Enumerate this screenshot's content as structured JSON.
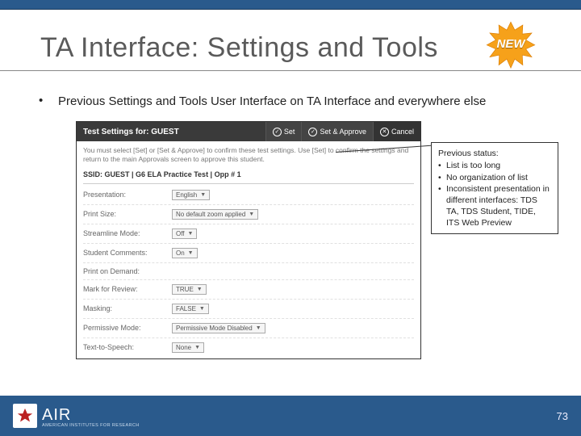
{
  "slide": {
    "title": "TA Interface: Settings and Tools",
    "new_badge": "NEW",
    "bullet": "Previous Settings and Tools User Interface on TA Interface and everywhere else"
  },
  "screenshot": {
    "header_title": "Test Settings for: GUEST",
    "buttons": {
      "set": "Set",
      "set_approve": "Set & Approve",
      "cancel": "Cancel"
    },
    "instruction": "You must select [Set] or [Set & Approve] to confirm these test settings. Use [Set] to confirm the settings and return to the main Approvals screen to approve this student.",
    "ssid_line": "SSID: GUEST | G6 ELA Practice Test | Opp # 1",
    "rows": [
      {
        "label": "Presentation:",
        "value": "English"
      },
      {
        "label": "Print Size:",
        "value": "No default zoom applied"
      },
      {
        "label": "Streamline Mode:",
        "value": "Off"
      },
      {
        "label": "Student Comments:",
        "value": "On"
      },
      {
        "label": "Print on Demand:",
        "value": ""
      },
      {
        "label": "Mark for Review:",
        "value": "TRUE"
      },
      {
        "label": "Masking:",
        "value": "FALSE"
      },
      {
        "label": "Permissive Mode:",
        "value": "Permissive Mode Disabled"
      },
      {
        "label": "Text-to-Speech:",
        "value": "None"
      }
    ]
  },
  "callout": {
    "heading": "Previous status:",
    "items": [
      "List is too long",
      "No organization of list",
      "Inconsistent presentation in different interfaces: TDS TA, TDS Student, TIDE, ITS Web Preview"
    ]
  },
  "footer": {
    "logo_mark": "AIR",
    "logo_big": "AIR",
    "logo_small": "AMERICAN INSTITUTES FOR RESEARCH",
    "page_number": "73"
  }
}
